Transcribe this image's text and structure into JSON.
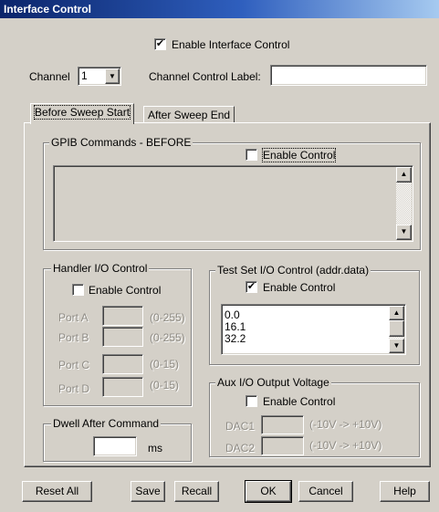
{
  "window": {
    "title": "Interface Control"
  },
  "enable_interface": {
    "label": "Enable Interface Control",
    "checked": true
  },
  "channel": {
    "label": "Channel",
    "value": "1",
    "control_label": "Channel Control Label:",
    "control_label_value": ""
  },
  "tabs": [
    {
      "label": "Before Sweep Start",
      "active": true
    },
    {
      "label": "After Sweep End",
      "active": false
    }
  ],
  "gpib": {
    "title": "GPIB Commands - BEFORE",
    "enable_label": "Enable Control",
    "checked": false,
    "text": ""
  },
  "handler": {
    "title": "Handler I/O Control",
    "enable_label": "Enable Control",
    "checked": false,
    "ports": [
      {
        "label": "Port A",
        "range": "(0-255)"
      },
      {
        "label": "Port B",
        "range": "(0-255)"
      },
      {
        "label": "Port C",
        "range": "(0-15)"
      },
      {
        "label": "Port D",
        "range": "(0-15)"
      }
    ]
  },
  "testset": {
    "title": "Test Set I/O Control (addr.data)",
    "enable_label": "Enable Control",
    "checked": true,
    "items": [
      "0.0",
      "16.1",
      "32.2"
    ]
  },
  "aux": {
    "title": "Aux I/O Output Voltage",
    "enable_label": "Enable Control",
    "checked": false,
    "dacs": [
      {
        "label": "DAC1",
        "range": "(-10V -> +10V)"
      },
      {
        "label": "DAC2",
        "range": "(-10V -> +10V)"
      }
    ]
  },
  "dwell": {
    "title": "Dwell After Command",
    "unit": "ms",
    "value": ""
  },
  "buttons": {
    "reset_all": "Reset All",
    "save": "Save",
    "recall": "Recall",
    "ok": "OK",
    "cancel": "Cancel",
    "help": "Help"
  },
  "glyphs": {
    "check": "✔",
    "dropdown": "▼",
    "up": "▲",
    "down": "▼"
  }
}
